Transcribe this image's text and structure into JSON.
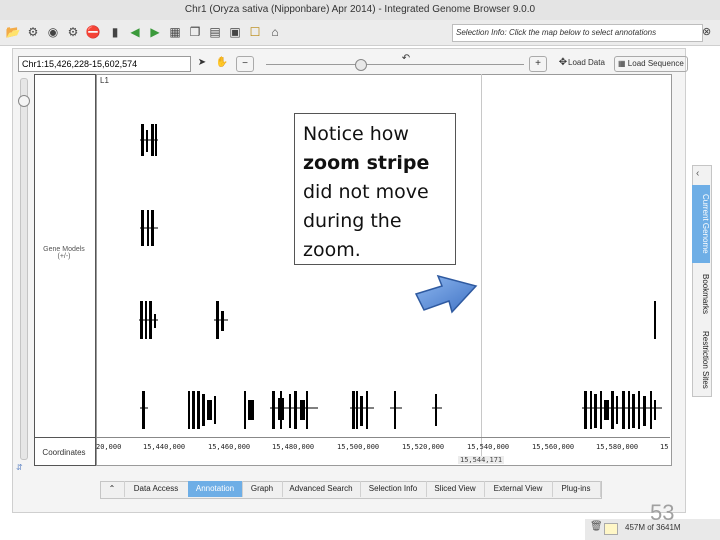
{
  "window": {
    "title": "Chr1 (Oryza sativa (Nipponbare) Apr 2014) - Integrated Genome Browser 9.0.0"
  },
  "toolbar": {
    "icons": [
      "open-file-icon",
      "options-icon",
      "camera-icon",
      "stop-icon",
      "bookmark-icon",
      "back-icon",
      "forward-icon",
      "table-icon",
      "copy-icon",
      "layout-icon",
      "comment-icon",
      "home-icon"
    ],
    "selection_info_label": "Selection Info:",
    "selection_info_text": "Click the map below to select annotations"
  },
  "navigation": {
    "coordinates": "Chr1:15,426,228-15,602,574",
    "load_data": "Load Data",
    "load_sequence": "Load Sequence"
  },
  "tracks": {
    "gene_models_label": "Gene Models",
    "gene_models_strand": "(+/-)",
    "coordinates_label": "Coordinates",
    "track_id": "L1"
  },
  "axis": {
    "ticks": [
      "20,000",
      "15,440,000",
      "15,460,000",
      "15,480,000",
      "15,500,000",
      "15,520,000",
      "15,540,000",
      "15,560,000",
      "15,580,000",
      "15"
    ],
    "zoom_position": "15,544,171"
  },
  "tabs": {
    "items": [
      "Data Access",
      "Annotation",
      "Graph",
      "Advanced Search",
      "Selection Info",
      "Sliced View",
      "External View",
      "Plug-ins"
    ],
    "active": "Annotation"
  },
  "side_tabs": {
    "items": [
      "Current Genome",
      "Bookmarks",
      "Restriction Sites"
    ],
    "active": "Current Genome"
  },
  "status": {
    "memory": "457M of 3641M"
  },
  "annotation": {
    "callout_line1": "Notice how",
    "callout_bold": "zoom stripe",
    "callout_rest1": "did not move",
    "callout_rest2": "during the",
    "callout_rest3": "zoom."
  },
  "slide_number": "53",
  "colors": {
    "accent": "#6eaee6",
    "arrow": "#4f86d4"
  }
}
